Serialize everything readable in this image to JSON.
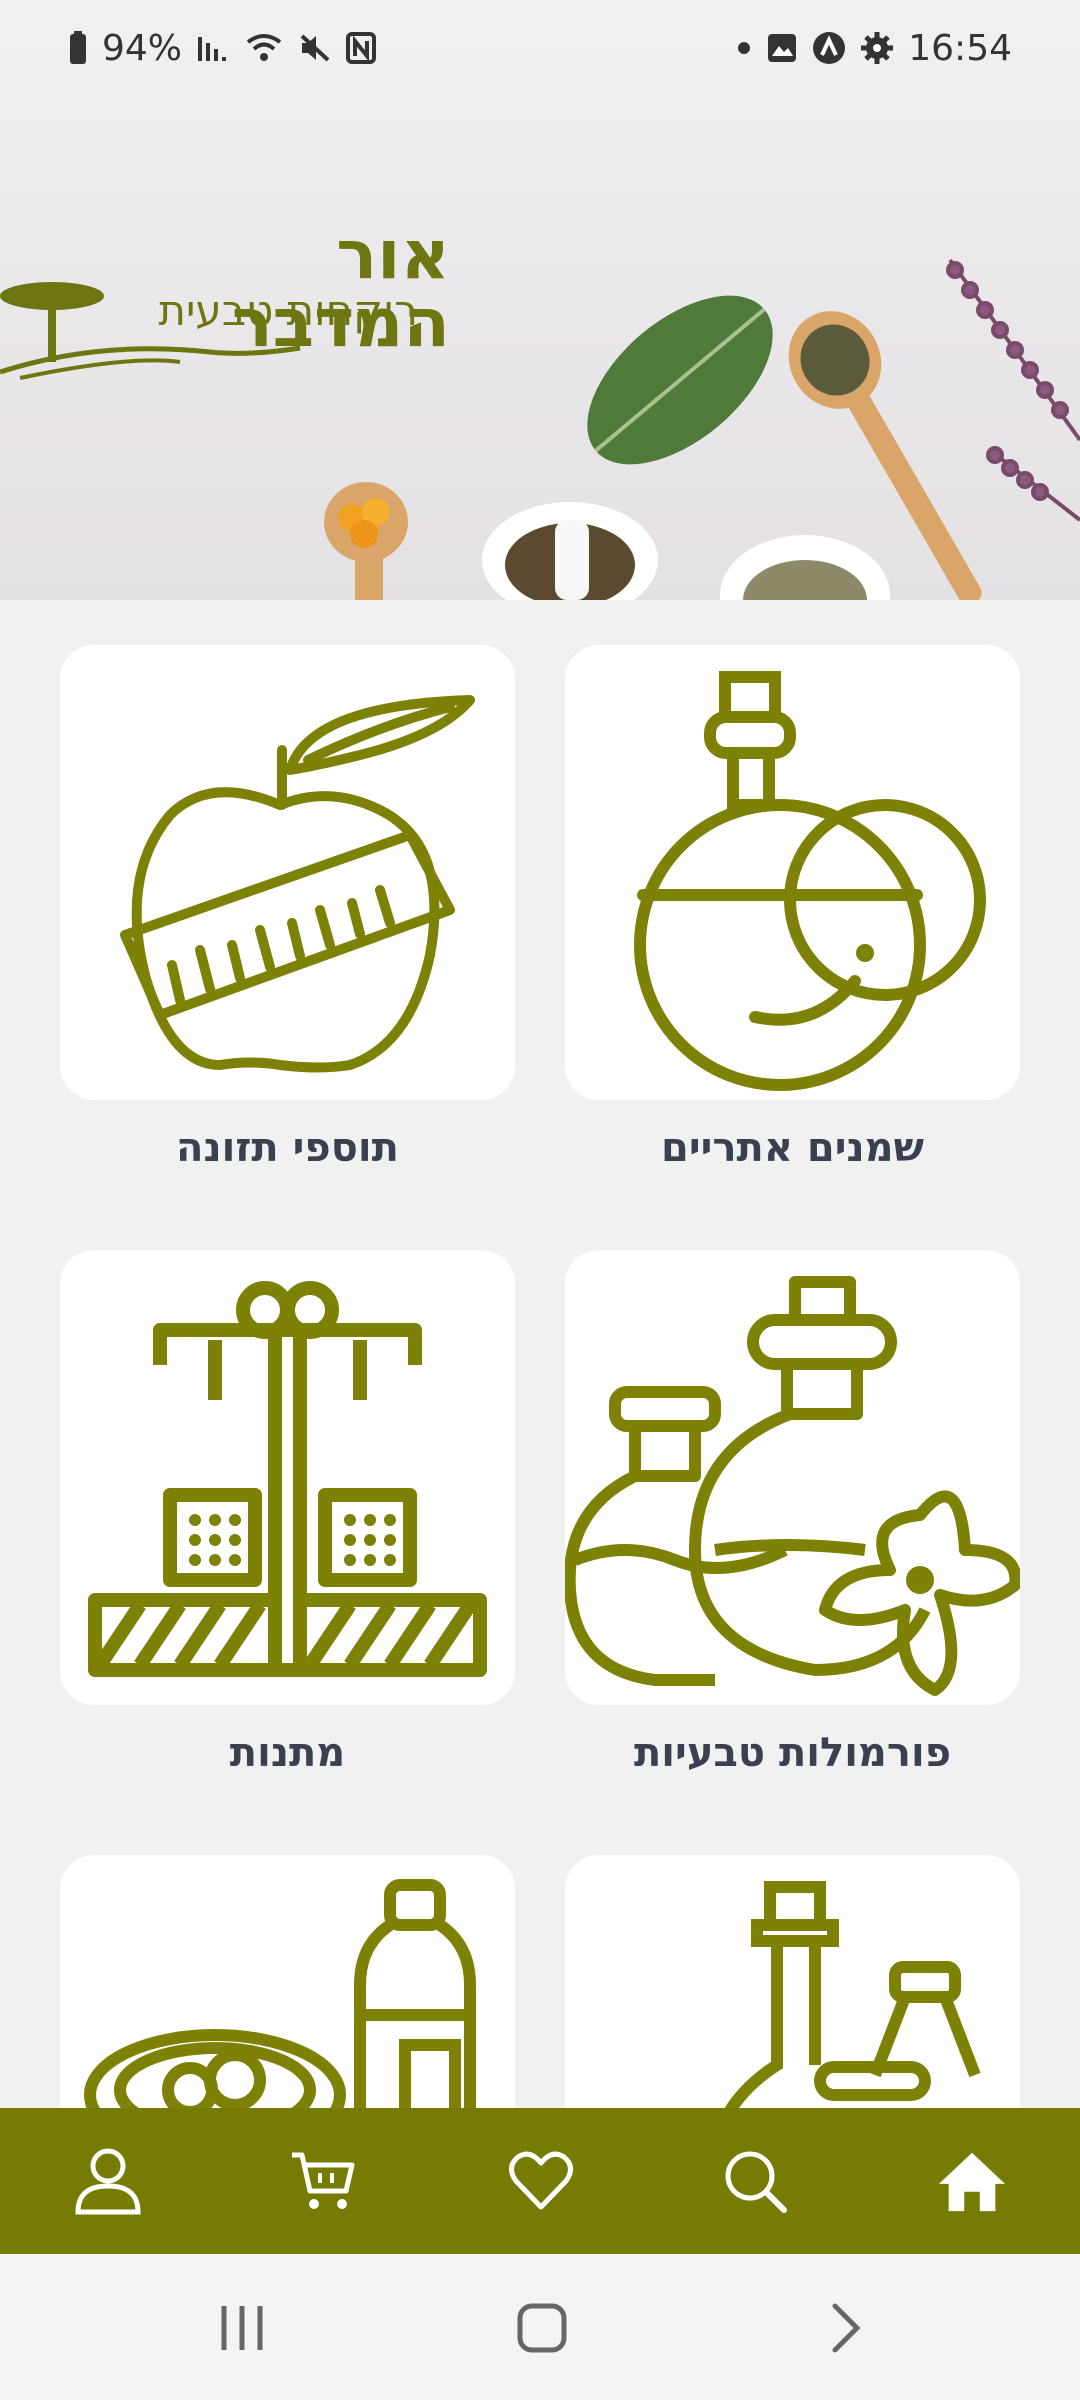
{
  "status_bar": {
    "battery": "94%",
    "time": "16:54",
    "icons_left": [
      "battery-icon",
      "signal-icon",
      "wifi-icon",
      "mute-icon",
      "nfc-icon"
    ],
    "icons_right": [
      "notification-dot-icon",
      "gallery-icon",
      "app-icon",
      "settings-icon"
    ]
  },
  "banner": {
    "logo_title": "אור המדבר",
    "logo_subtitle": "רוקחות טבעית"
  },
  "categories": [
    {
      "label": "שמנים אתריים",
      "icon": "oil-flask-icon"
    },
    {
      "label": "תוספי תזונה",
      "icon": "apple-tape-icon"
    },
    {
      "label": "פורמולות טבעיות",
      "icon": "bottles-flower-icon"
    },
    {
      "label": "מתנות",
      "icon": "gift-boxes-icon"
    },
    {
      "label": "",
      "icon": "bottles-icon"
    },
    {
      "label": "",
      "icon": "bowl-bottle-icon"
    }
  ],
  "bottom_nav": {
    "items": [
      "profile-icon",
      "cart-icon",
      "heart-icon",
      "search-icon",
      "home-icon"
    ]
  },
  "colors": {
    "brand": "#767b04",
    "icon_olive": "#7d8207",
    "label": "#3b4050"
  }
}
